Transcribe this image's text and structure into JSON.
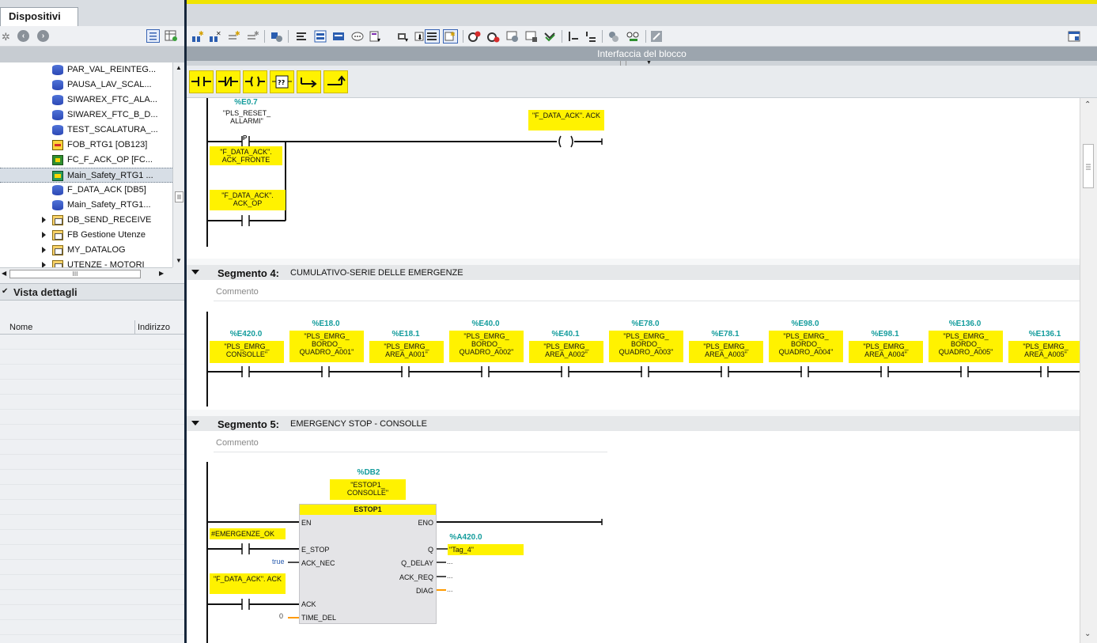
{
  "left_panel": {
    "tab_label": "Dispositivi",
    "tree_items": [
      {
        "label": "PAR_VAL_REINTEG...",
        "icon": "db",
        "expand": false,
        "selected": false
      },
      {
        "label": "PAUSA_LAV_SCAL...",
        "icon": "db",
        "expand": false,
        "selected": false
      },
      {
        "label": "SIWAREX_FTC_ALA...",
        "icon": "db",
        "expand": false,
        "selected": false
      },
      {
        "label": "SIWAREX_FTC_B_D...",
        "icon": "db-locked",
        "expand": false,
        "selected": false
      },
      {
        "label": "TEST_SCALATURA_...",
        "icon": "db",
        "expand": false,
        "selected": false
      },
      {
        "label": "FOB_RTG1 [OB123]",
        "icon": "ob",
        "expand": false,
        "selected": false
      },
      {
        "label": "FC_F_ACK_OP [FC...",
        "icon": "fc",
        "expand": false,
        "selected": false
      },
      {
        "label": "Main_Safety_RTG1 ...",
        "icon": "fb-safety",
        "expand": false,
        "selected": true
      },
      {
        "label": "F_DATA_ACK [DB5]",
        "icon": "db",
        "expand": false,
        "selected": false
      },
      {
        "label": "Main_Safety_RTG1...",
        "icon": "db",
        "expand": false,
        "selected": false
      },
      {
        "label": "DB_SEND_RECEIVE",
        "icon": "folder",
        "expand": true,
        "selected": false
      },
      {
        "label": "FB Gestione Utenze",
        "icon": "folder",
        "expand": true,
        "selected": false
      },
      {
        "label": "MY_DATALOG",
        "icon": "folder",
        "expand": true,
        "selected": false
      },
      {
        "label": "UTENZE - MOTORI",
        "icon": "folder",
        "expand": true,
        "selected": false
      }
    ],
    "hscroll_thumb": "III",
    "detail_view": {
      "title": "Vista dettagli",
      "columns": [
        "Nome",
        "Indirizzo"
      ]
    }
  },
  "editor": {
    "interface_bar_label": "Interfaccia del blocco",
    "favorites": [
      "-| |-",
      "-|/|-",
      "-( )-",
      "??",
      "↦",
      "↱"
    ],
    "network3": {
      "contact_addr": "%E0.7",
      "contact_tag": "\"PLS_RESET_ ALLARMI\"",
      "edge_label": "P",
      "edge_tag": "\"F_DATA_ACK\". ACK_FRONTE",
      "coil_tag": "\"F_DATA_ACK\". ACK",
      "parallel_tag": "\"F_DATA_ACK\". ACK_OP"
    },
    "network4": {
      "number": "Segmento 4:",
      "title": "CUMULATIVO-SERIE DELLE EMERGENZE",
      "comment": "Commento",
      "contacts": [
        {
          "addr": "%E420.0",
          "tag": "\"PLS_EMRG_ CONSOLLE\""
        },
        {
          "addr": "%E18.0",
          "tag": "\"PLS_EMRG_ BORDO_ QUADRO_A001\""
        },
        {
          "addr": "%E18.1",
          "tag": "\"PLS_EMRG_ AREA_A001\""
        },
        {
          "addr": "%E40.0",
          "tag": "\"PLS_EMRG_ BORDO_ QUADRO_A002\""
        },
        {
          "addr": "%E40.1",
          "tag": "\"PLS_EMRG_ AREA_A002\""
        },
        {
          "addr": "%E78.0",
          "tag": "\"PLS_EMRG_ BORDO_ QUADRO_A003\""
        },
        {
          "addr": "%E78.1",
          "tag": "\"PLS_EMRG_ AREA_A003\""
        },
        {
          "addr": "%E98.0",
          "tag": "\"PLS_EMRG_ BORDO_ QUADRO_A004\""
        },
        {
          "addr": "%E98.1",
          "tag": "\"PLS_EMRG_ AREA_A004\""
        },
        {
          "addr": "%E136.0",
          "tag": "\"PLS_EMRG_ BORDO_ QUADRO_A005\""
        },
        {
          "addr": "%E136.1",
          "tag": "\"PLS_EMRG_ AREA_A005\""
        }
      ]
    },
    "network5": {
      "number": "Segmento 5:",
      "title": "EMERGENCY STOP - CONSOLLE",
      "comment": "Commento",
      "instance_addr": "%DB2",
      "instance_tag": "\"ESTOP1_ CONSOLLE\"",
      "block_name": "ESTOP1",
      "pins": {
        "en": "EN",
        "eno": "ENO",
        "e_stop": "E_STOP",
        "ack_nec": "ACK_NEC",
        "ack": "ACK",
        "time_del": "TIME_DEL",
        "q": "Q",
        "q_delay": "Q_DELAY",
        "ack_req": "ACK_REQ",
        "diag": "DIAG"
      },
      "estop_tag": "#EMERGENZE_OK",
      "ack_tag": "\"F_DATA_ACK\". ACK",
      "ack_nec_value": "true",
      "time_del_value": "0",
      "q_addr": "%A420.0",
      "q_tag": "\"Tag_4\"",
      "open_out": "..."
    }
  },
  "colors": {
    "tag_bg": "#fff200",
    "address": "#139c9c",
    "splitter": "#16263a"
  }
}
